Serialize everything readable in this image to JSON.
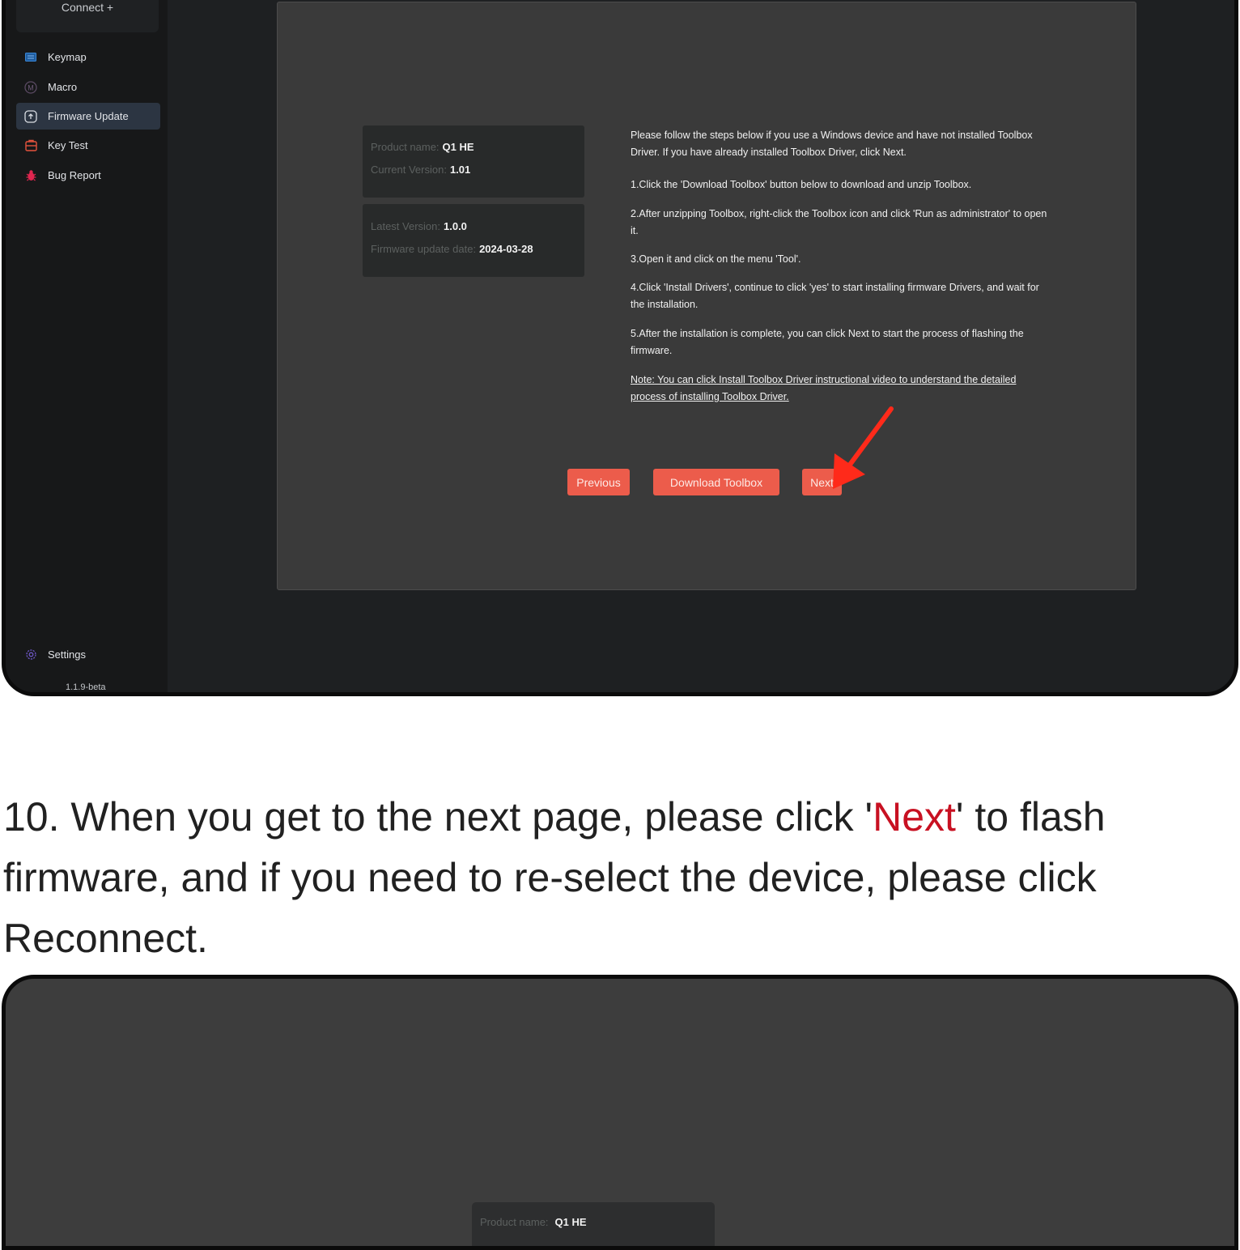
{
  "screenshot1": {
    "sidebar": {
      "connect_label": "Connect +",
      "items": [
        {
          "label": "Keymap",
          "icon": "keymap-icon"
        },
        {
          "label": "Macro",
          "icon": "macro-icon"
        },
        {
          "label": "Firmware Update",
          "icon": "firmware-update-icon",
          "active": true
        },
        {
          "label": "Key Test",
          "icon": "key-test-icon"
        },
        {
          "label": "Bug Report",
          "icon": "bug-icon"
        }
      ],
      "settings_label": "Settings",
      "version": "1.1.9-beta"
    },
    "product_card": {
      "product_name_label": "Product name:",
      "product_name": "Q1 HE",
      "current_version_label": "Current Version:",
      "current_version": "1.01"
    },
    "firmware_card": {
      "latest_version_label": "Latest Version:",
      "latest_version": "1.0.0",
      "update_date_label": "Firmware update date:",
      "update_date": "2024-03-28"
    },
    "instructions": {
      "intro": "Please follow the steps below if you use a Windows device and have not installed Toolbox Driver. If you have already installed Toolbox Driver, click Next.",
      "step1": "1.Click the 'Download Toolbox' button below to download and unzip Toolbox.",
      "step2": "2.After unzipping Toolbox, right-click the Toolbox icon and click 'Run as administrator' to open it.",
      "step3": "3.Open it and click on the menu 'Tool'.",
      "step4": "4.Click 'Install Drivers', continue to click 'yes' to start installing firmware Drivers, and wait for the installation.",
      "step5": "5.After the installation is complete, you can click Next to start the process of flashing the firmware.",
      "note": "Note: You can click Install Toolbox Driver instructional video to understand the detailed process of installing Toolbox Driver."
    },
    "buttons": {
      "previous": "Previous",
      "download": "Download Toolbox",
      "next": "Next"
    },
    "colors": {
      "button": "#ec5c4b",
      "arrow": "#ff2a1a",
      "active_nav": "#2c3542"
    }
  },
  "tutorial": {
    "part1": "10. When you get to the next page, please click '",
    "highlight": "Next",
    "part2": "' to flash firmware, and if you need to re-select the device, please click Reconnect.",
    "highlight_color": "#c81122"
  },
  "screenshot2": {
    "card_label_partial": "Product name:",
    "card_value_partial": "Q1 HE"
  }
}
